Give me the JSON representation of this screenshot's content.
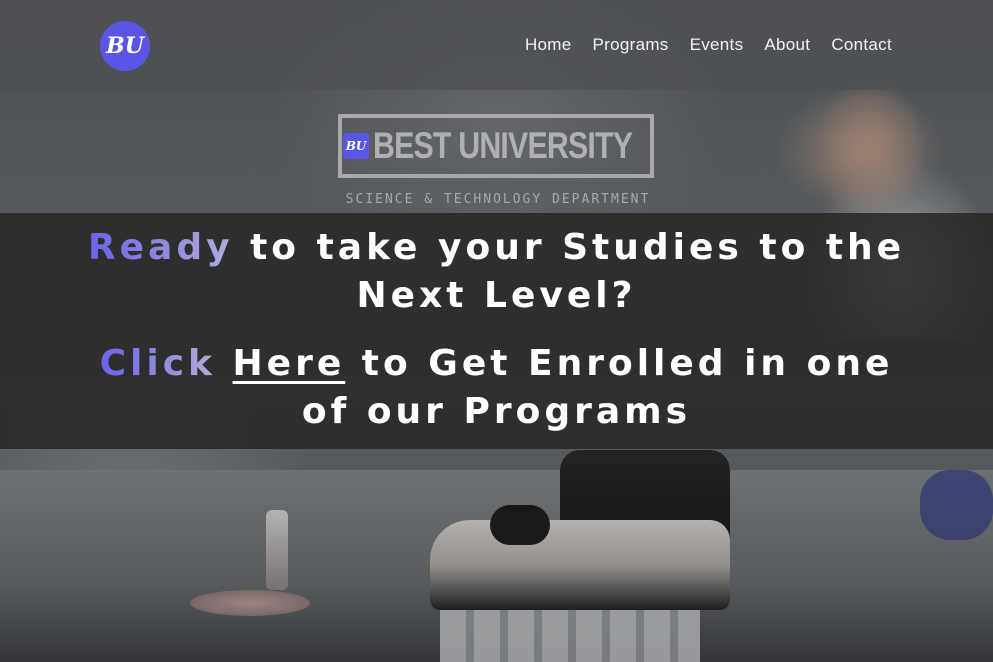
{
  "header": {
    "logo_text": "BU",
    "nav": [
      "Home",
      "Programs",
      "Events",
      "About",
      "Contact"
    ]
  },
  "brand": {
    "mark": "BU",
    "name": "BEST UNIVERSITY",
    "subtitle": "SCIENCE & TECHNOLOGY DEPARTMENT"
  },
  "banner": {
    "line1_accent": "Ready",
    "line1_rest": " to take your Studies to the",
    "line2": "Next Level?",
    "line3_accent": "Click",
    "line3_link": "Here",
    "line3_rest": " to Get Enrolled in one",
    "line4": "of our Programs"
  },
  "colors": {
    "accent": "#5b55e6",
    "banner_bg": "#262626",
    "header_bg": "#4e5054"
  },
  "background": {
    "description_icon": "lab-microscope-photo"
  }
}
